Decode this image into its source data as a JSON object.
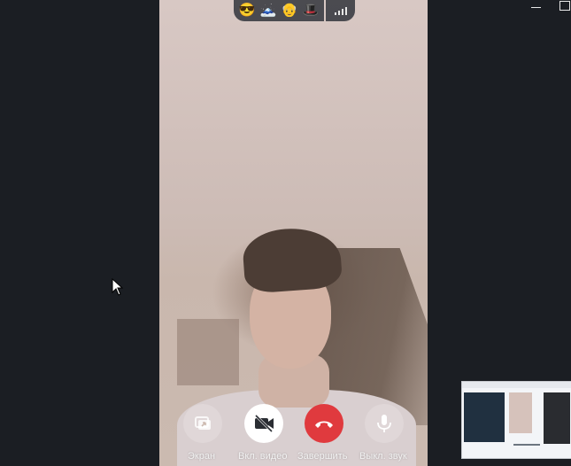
{
  "controls": {
    "screen_label": "Экран",
    "video_label": "Вкл. видео",
    "end_label": "Завершить",
    "mic_label": "Выкл. звук"
  },
  "participants_bar": {
    "emojis": [
      "😎",
      "🗻",
      "👴",
      "🎩"
    ]
  },
  "icons": {
    "screen": "screen-share-icon",
    "video": "video-off-icon",
    "end": "hang-up-icon",
    "mic": "microphone-icon",
    "signal": "signal-strength-icon",
    "minimize": "minimize-icon",
    "maximize": "maximize-icon",
    "cursor": "mouse-cursor-icon"
  },
  "colors": {
    "background": "#1b1e23",
    "end_call": "#e03a3e",
    "video_button": "#ffffff"
  }
}
